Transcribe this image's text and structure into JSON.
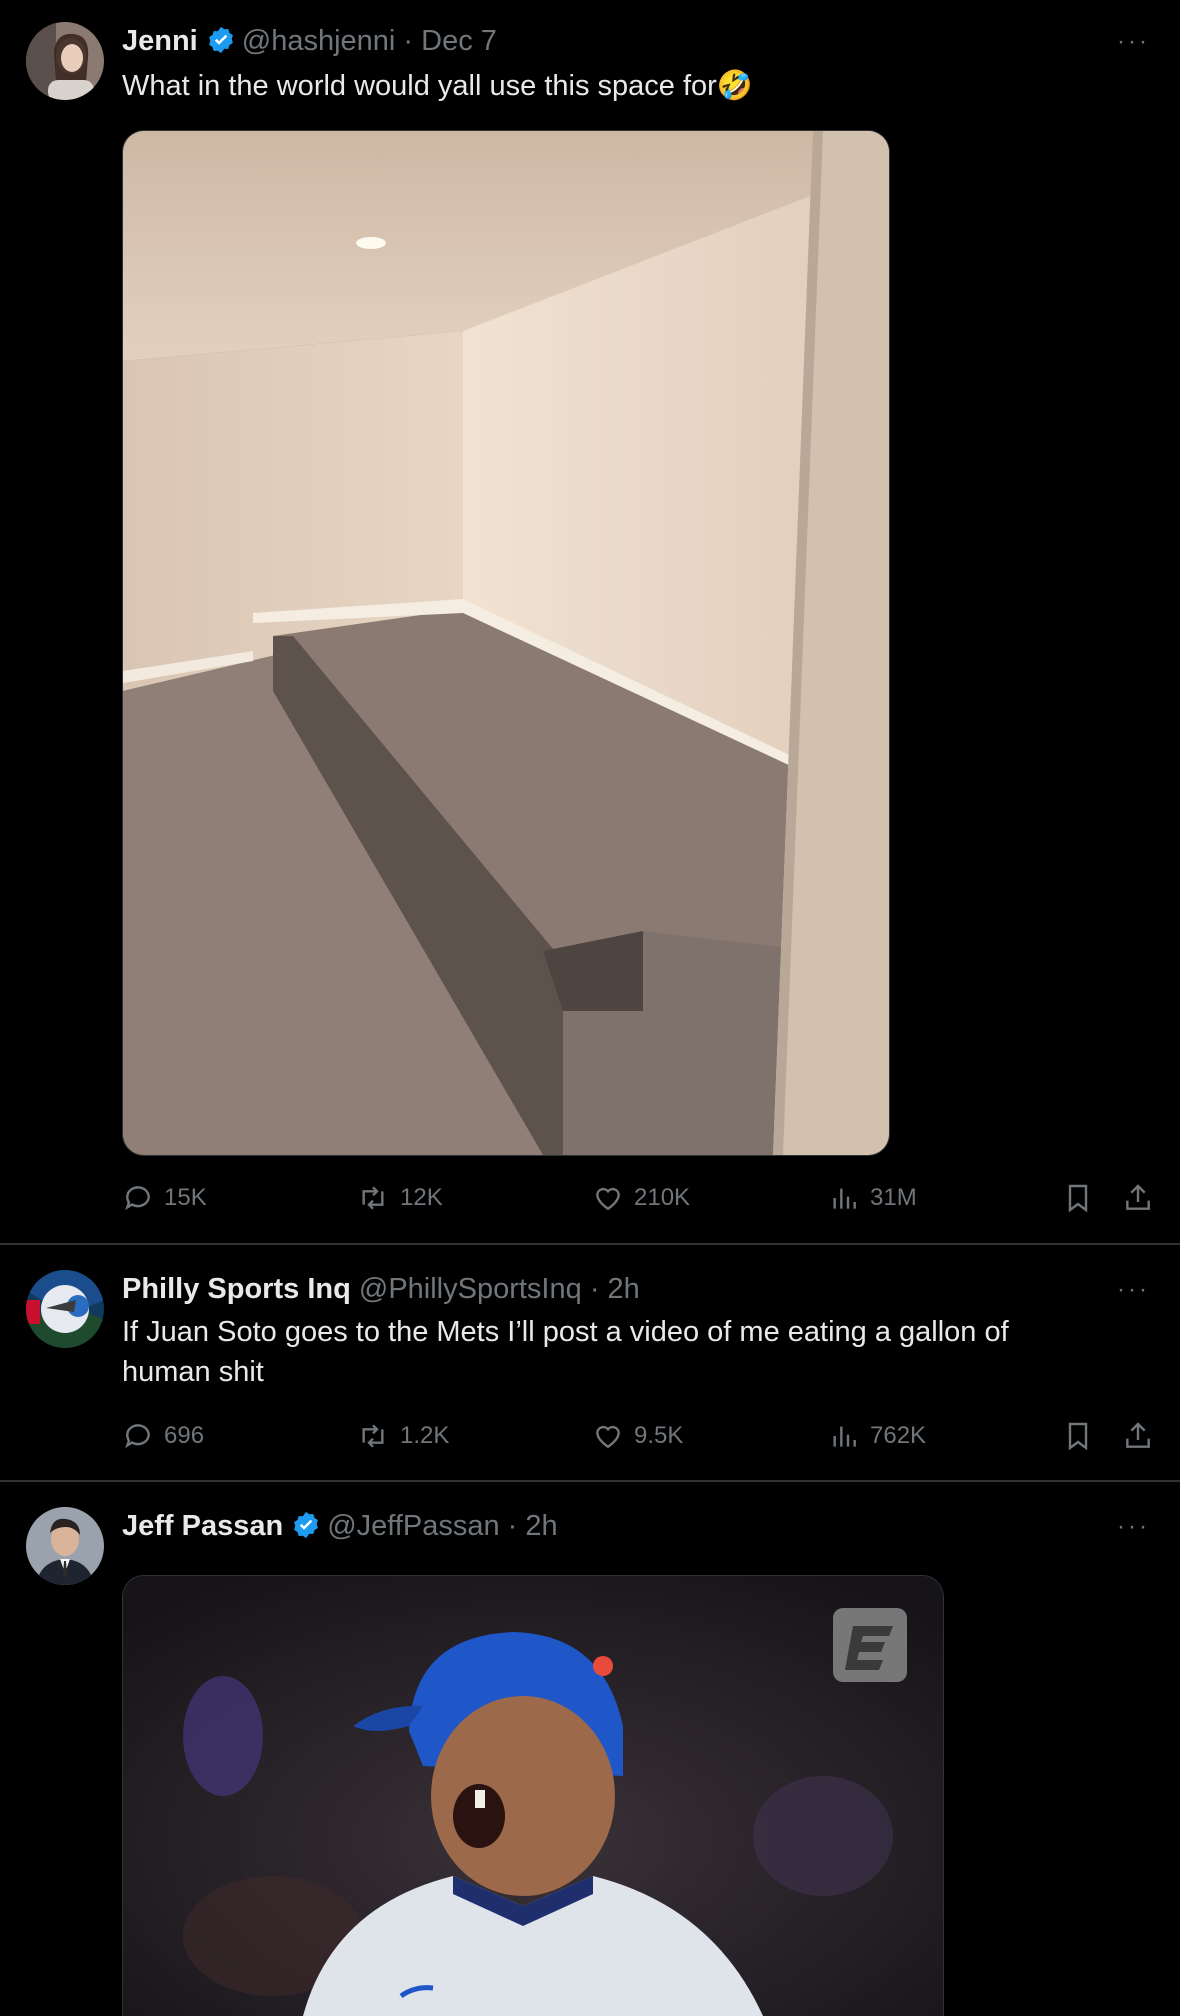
{
  "tweets": [
    {
      "name": "Jenni",
      "handle": "@hashjenni",
      "separator": "·",
      "time": "Dec 7",
      "text": "What in the world would yall use this space for🤣",
      "stats": {
        "replies": "15K",
        "reposts": "12K",
        "likes": "210K",
        "views": "31M"
      }
    },
    {
      "name": "Philly Sports Inq",
      "handle": "@PhillySportsInq",
      "separator": "·",
      "time": "2h",
      "text": "If Juan Soto goes to the Mets I’ll post a video of me eating a gallon of human shit",
      "stats": {
        "replies": "696",
        "reposts": "1.2K",
        "likes": "9.5K",
        "views": "762K"
      }
    },
    {
      "name": "Jeff Passan",
      "handle": "@JeffPassan",
      "separator": "·",
      "time": "2h"
    }
  ],
  "more_label": "···",
  "colors": {
    "background": "#000000",
    "verified": "#1d9bf0",
    "muted": "#71767b",
    "divider": "#2f3336"
  }
}
